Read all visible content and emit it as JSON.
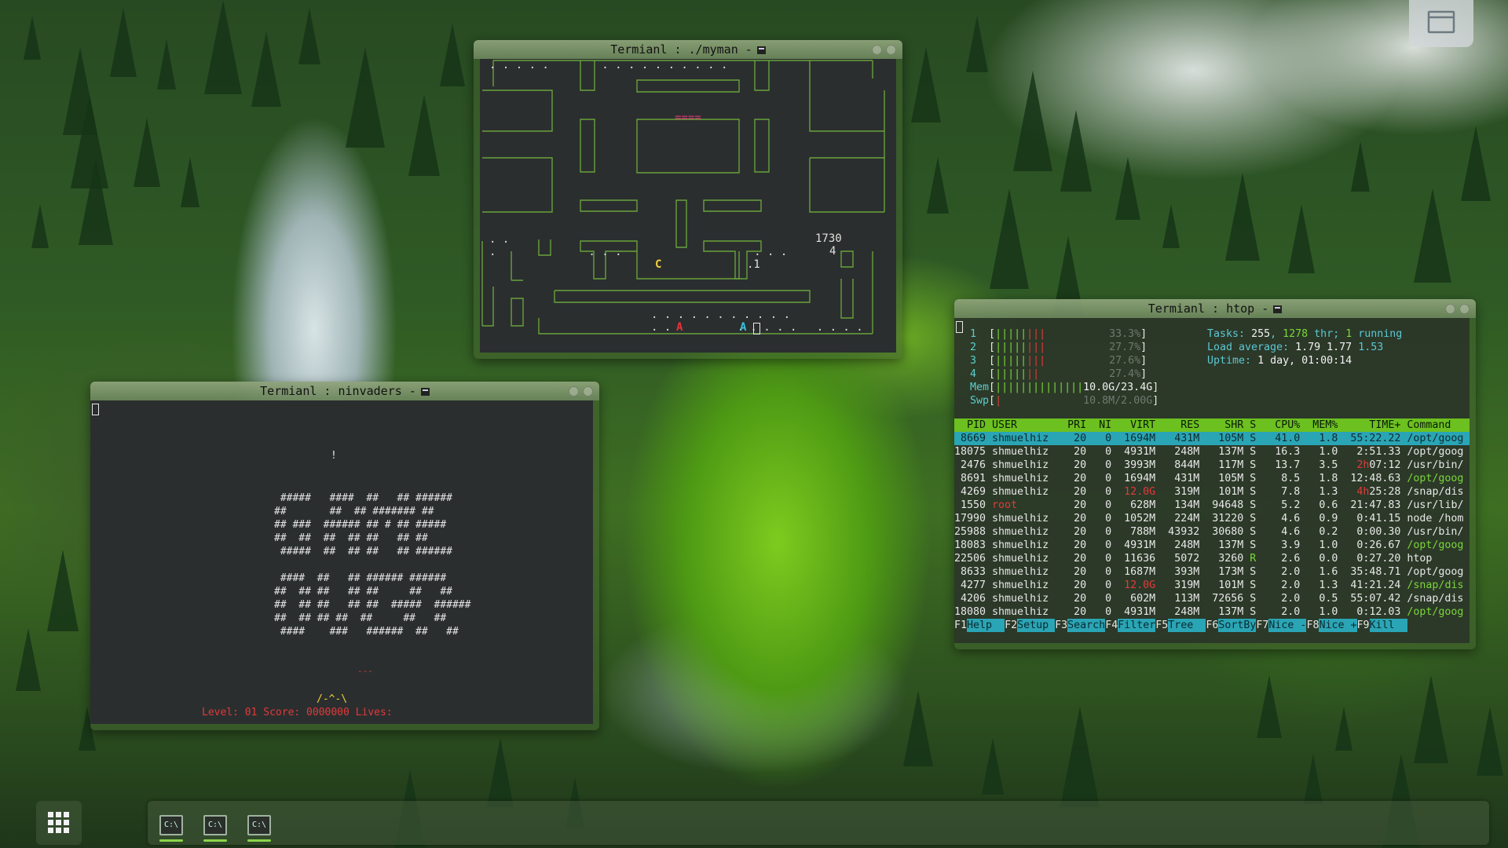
{
  "wallpaper": {
    "name": "forest-waterfall"
  },
  "windows": {
    "myman": {
      "title": "Termianl : ./myman -",
      "score": "1730",
      "lives": "4",
      "ghost_house": "====",
      "pacman": "C",
      "ghosts": [
        {
          "ch": "A",
          "color": "#e8323a"
        },
        {
          "ch": "A",
          "color": "#3cc3e0"
        }
      ],
      "fruit": ".1",
      "dots_rows": [
        ". . . . .        . . . . . . . . . .",
        ". .",
        ".              . . .                    . . .",
        ". . . . . . . . . . .",
        ". .          . . . . .   . . . ."
      ]
    },
    "ninvaders": {
      "title": "Termianl : ninvaders -",
      "bomb": "!",
      "logo_lines": [
        " #####   ####  ##   ## ######",
        "##       ##  ## ####### ##",
        "## ###  ###### ## # ## #####",
        "##  ##  ##  ## ##   ## ##",
        " #####  ##  ## ##   ## ######",
        "",
        " ####  ##   ## ###### ######",
        "##  ## ##   ## ##     ##   ##",
        "##  ## ##   ## ##  #####  ######",
        "##  ## ## ##  ##     ##   ##",
        " ####    ###   ######  ##   ##"
      ],
      "ufo": "---",
      "ship": "/-^-\\",
      "status": "Level: 01 Score: 0000000 Lives:"
    },
    "htop": {
      "title": "Termianl : htop -",
      "cpus": [
        {
          "n": "1",
          "bar": "||||||||",
          "pct": "33.3%"
        },
        {
          "n": "2",
          "bar": "||||||||",
          "pct": "27.7%"
        },
        {
          "n": "3",
          "bar": "||||||||",
          "pct": "27.6%"
        },
        {
          "n": "4",
          "bar": "|||||||",
          "pct": "27.4%"
        }
      ],
      "mem": {
        "label": "Mem",
        "bar": "||||||||||||||",
        "value": "10.0G/23.4G"
      },
      "swp": {
        "label": "Swp",
        "bar": "|",
        "value": "10.8M/2.00G"
      },
      "tasks": {
        "label": "Tasks:",
        "tasks": "255",
        "thr": "1278",
        "thr_label": "thr;",
        "running": "1",
        "running_label": "running"
      },
      "load": {
        "label": "Load average:",
        "v1": "1.79",
        "v2": "1.77",
        "v3": "1.53"
      },
      "uptime": {
        "label": "Uptime:",
        "value": "1 day, 01:00:14"
      },
      "header": [
        "PID",
        "USER",
        "PRI",
        "NI",
        "VIRT",
        "RES",
        "SHR",
        "S",
        "CPU%",
        "MEM%",
        "TIME+",
        "Command"
      ],
      "rows": [
        [
          "8669",
          "shmuelhiz",
          "20",
          "0",
          "1694M",
          "431M",
          "105M",
          "S",
          "41.0",
          "1.8",
          "55:22.22",
          "/opt/goog"
        ],
        [
          "18075",
          "shmuelhiz",
          "20",
          "0",
          "4931M",
          "248M",
          "137M",
          "S",
          "16.3",
          "1.0",
          "2:51.33",
          "/opt/goog"
        ],
        [
          "2476",
          "shmuelhiz",
          "20",
          "0",
          "3993M",
          "844M",
          "117M",
          "S",
          "13.7",
          "3.5",
          "2h07:12",
          "/usr/bin/"
        ],
        [
          "8691",
          "shmuelhiz",
          "20",
          "0",
          "1694M",
          "431M",
          "105M",
          "S",
          "8.5",
          "1.8",
          "12:48.63",
          "/opt/goog"
        ],
        [
          "4269",
          "shmuelhiz",
          "20",
          "0",
          "12.0G",
          "319M",
          "101M",
          "S",
          "7.8",
          "1.3",
          "4h25:28",
          "/snap/dis"
        ],
        [
          "1550",
          "root",
          "20",
          "0",
          "628M",
          "134M",
          "94648",
          "S",
          "5.2",
          "0.6",
          "21:47.83",
          "/usr/lib/"
        ],
        [
          "17990",
          "shmuelhiz",
          "20",
          "0",
          "1052M",
          "224M",
          "31220",
          "S",
          "4.6",
          "0.9",
          "0:41.15",
          "node /hom"
        ],
        [
          "25988",
          "shmuelhiz",
          "20",
          "0",
          "788M",
          "43932",
          "30680",
          "S",
          "4.6",
          "0.2",
          "0:00.30",
          "/usr/bin/"
        ],
        [
          "18083",
          "shmuelhiz",
          "20",
          "0",
          "4931M",
          "248M",
          "137M",
          "S",
          "3.9",
          "1.0",
          "0:26.67",
          "/opt/goog"
        ],
        [
          "22506",
          "shmuelhiz",
          "20",
          "0",
          "11636",
          "5072",
          "3260",
          "R",
          "2.6",
          "0.0",
          "0:27.20",
          "htop"
        ],
        [
          "8633",
          "shmuelhiz",
          "20",
          "0",
          "1687M",
          "393M",
          "173M",
          "S",
          "2.0",
          "1.6",
          "35:48.71",
          "/opt/goog"
        ],
        [
          "4277",
          "shmuelhiz",
          "20",
          "0",
          "12.0G",
          "319M",
          "101M",
          "S",
          "2.0",
          "1.3",
          "41:21.24",
          "/snap/dis"
        ],
        [
          "4206",
          "shmuelhiz",
          "20",
          "0",
          "602M",
          "113M",
          "72656",
          "S",
          "2.0",
          "0.5",
          "55:07.42",
          "/snap/dis"
        ],
        [
          "18080",
          "shmuelhiz",
          "20",
          "0",
          "4931M",
          "248M",
          "137M",
          "S",
          "2.0",
          "1.0",
          "0:12.03",
          "/opt/goog"
        ]
      ],
      "fkeys": [
        {
          "key": "F1",
          "label": "Help  "
        },
        {
          "key": "F2",
          "label": "Setup "
        },
        {
          "key": "F3",
          "label": "Search"
        },
        {
          "key": "F4",
          "label": "Filter"
        },
        {
          "key": "F5",
          "label": "Tree  "
        },
        {
          "key": "F6",
          "label": "SortBy"
        },
        {
          "key": "F7",
          "label": "Nice -"
        },
        {
          "key": "F8",
          "label": "Nice +"
        },
        {
          "key": "F9",
          "label": "Kill  "
        }
      ]
    }
  },
  "taskbar": {
    "apps": [
      {
        "name": "terminal-myman",
        "icon_text": "C:\\"
      },
      {
        "name": "terminal-ninvaders",
        "icon_text": "C:\\"
      },
      {
        "name": "terminal-htop",
        "icon_text": "C:\\"
      }
    ],
    "accent": "#8ad64a"
  }
}
